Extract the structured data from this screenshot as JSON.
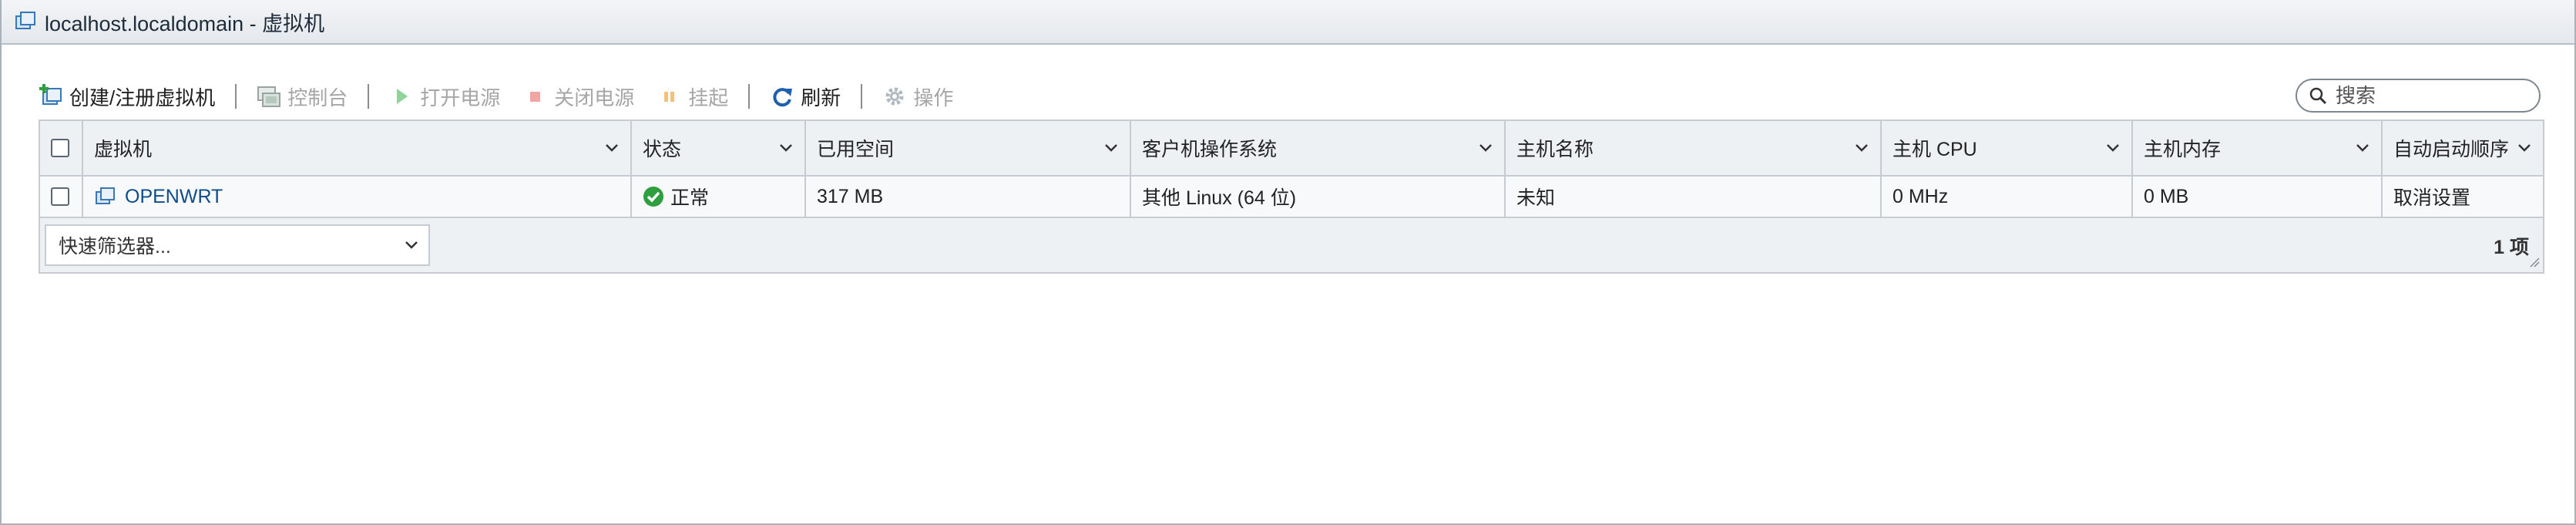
{
  "window": {
    "title": "localhost.localdomain - 虚拟机"
  },
  "toolbar": {
    "create_label": "创建/注册虚拟机",
    "console_label": "控制台",
    "power_on_label": "打开电源",
    "power_off_label": "关闭电源",
    "suspend_label": "挂起",
    "refresh_label": "刷新",
    "actions_label": "操作"
  },
  "search": {
    "placeholder": "搜索"
  },
  "table": {
    "columns": [
      "虚拟机",
      "状态",
      "已用空间",
      "客户机操作系统",
      "主机名称",
      "主机 CPU",
      "主机内存",
      "自动启动顺序"
    ],
    "rows": [
      {
        "name": "OPENWRT",
        "status": "正常",
        "used_space": "317 MB",
        "guest_os": "其他 Linux (64 位)",
        "host_name": "未知",
        "host_cpu": "0 MHz",
        "host_memory": "0 MB",
        "autostart": "取消设置"
      }
    ]
  },
  "footer": {
    "quick_filter_placeholder": "快速筛选器...",
    "item_count": "1 项"
  },
  "colors": {
    "header_bg": "#eef1f4",
    "border": "#c6ccd2",
    "link": "#0f4d8a",
    "status_ok": "#2e9e3e",
    "refresh_blue": "#1f5fae"
  }
}
